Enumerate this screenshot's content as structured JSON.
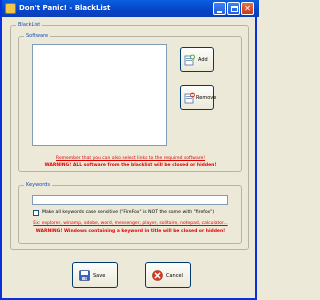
{
  "window": {
    "title": "Don't Panic! - BlackList"
  },
  "blacklist": {
    "group_label": "BlackList",
    "software_label": "Software",
    "add_label": "Add",
    "remove_label": "Remove",
    "hint": "Remember that you can also select links to the required software!",
    "warning": "WARNING! ALL software from the blacklist will be closed or hidden!"
  },
  "keywords": {
    "group_label": "Keywords",
    "input_value": "",
    "case_sensitive_label": "Make all keywords case sensitive (\"FireFox\" is NOT the same with \"firefox\")",
    "example": "Ex: explorer, winamp, adobe, word, messenger, player, solitaire, notepad, calculator...",
    "warning": "WARNING! Windows containing a keyword in title will be closed or hidden!"
  },
  "footer": {
    "save_label": "Save",
    "cancel_label": "Cancel"
  },
  "colors": {
    "title_bar": "#0a4fd0",
    "warning_red": "#e00000",
    "group_label_blue": "#0e4fb5"
  }
}
